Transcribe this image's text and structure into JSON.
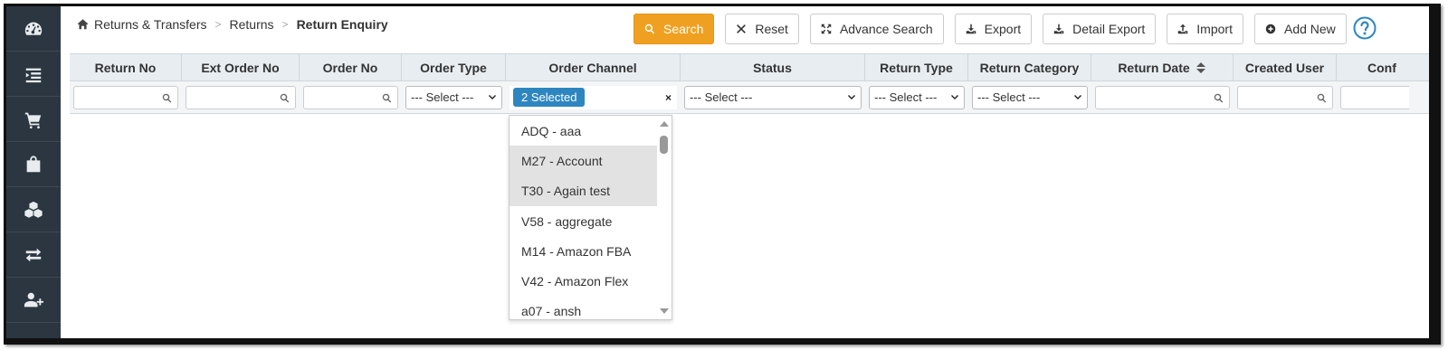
{
  "breadcrumb": {
    "items": [
      "Returns & Transfers",
      "Returns"
    ],
    "current": "Return Enquiry"
  },
  "toolbar": {
    "search": "Search",
    "reset": "Reset",
    "advance_search": "Advance Search",
    "export": "Export",
    "detail_export": "Detail Export",
    "import": "Import",
    "add_new": "Add New"
  },
  "colors": {
    "accent": "#f0a020",
    "sidebar": "#2b3640",
    "chip": "#2e86c1",
    "help": "#2e86c1"
  },
  "sidebar": {
    "icons": [
      "dashboard-icon",
      "list-icon",
      "cart-icon",
      "bag-icon",
      "boxes-icon",
      "transfer-icon",
      "add-user-icon"
    ]
  },
  "grid": {
    "columns": [
      "Return No",
      "Ext Order No",
      "Order No",
      "Order Type",
      "Order Channel",
      "Status",
      "Return Type",
      "Return Category",
      "Return Date",
      "Created User",
      "Conf"
    ],
    "filters": {
      "order_type": "--- Select ---",
      "order_channel_chip": "2 Selected",
      "status": "--- Select ---",
      "return_type": "--- Select ---",
      "return_category": "--- Select ---"
    },
    "clear_glyph": "×"
  },
  "dropdown": {
    "options": [
      {
        "label": "ADQ - aaa",
        "selected": false
      },
      {
        "label": "M27 - Account",
        "selected": true
      },
      {
        "label": "T30 - Again test",
        "selected": true
      },
      {
        "label": "V58 - aggregate",
        "selected": false
      },
      {
        "label": "M14 - Amazon FBA",
        "selected": false
      },
      {
        "label": "V42 - Amazon Flex",
        "selected": false
      },
      {
        "label": "a07 - ansh",
        "selected": false
      }
    ]
  }
}
